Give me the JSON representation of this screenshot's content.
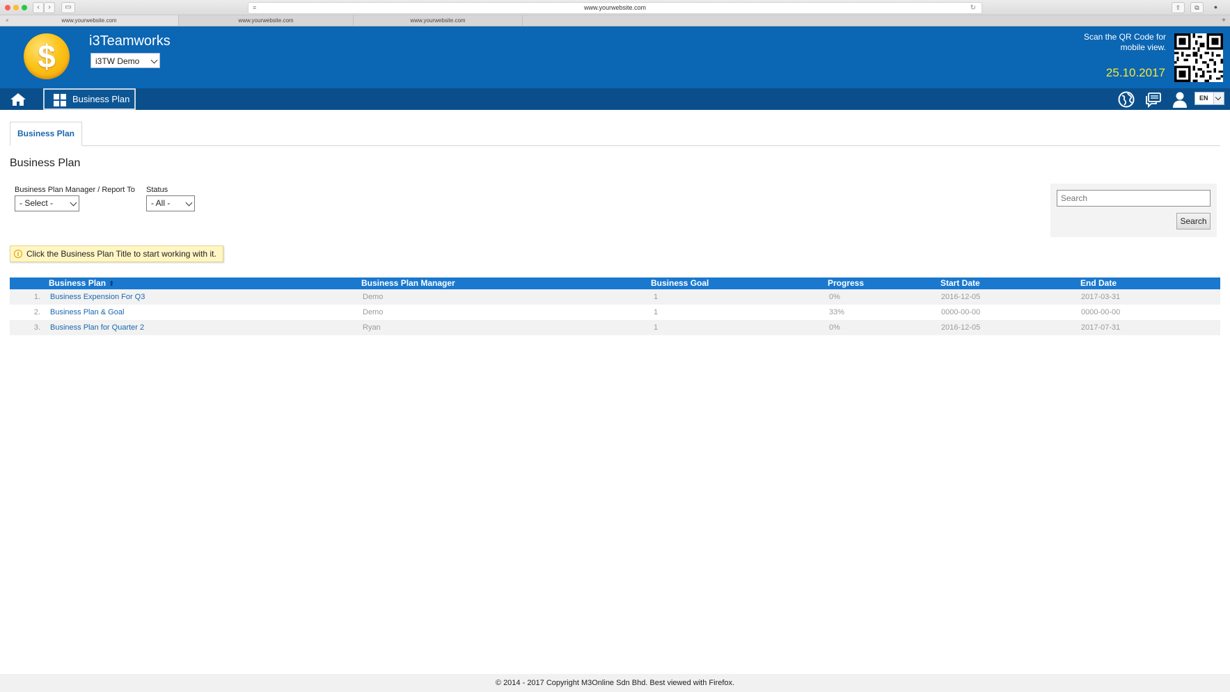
{
  "browser": {
    "url": "www.yourwebsite.com",
    "tabs": [
      "www.yourwebsite.com",
      "www.yourwebsite.com",
      "www.yourwebsite.com"
    ],
    "new_tab": "+",
    "close_tab": "×"
  },
  "header": {
    "app_name": "i3Teamworks",
    "company": "i3TW Demo",
    "qr_note": "Scan the QR Code for mobile view.",
    "date": "25.10.2017",
    "logo_symbol": "$"
  },
  "nav": {
    "module_label": "Business Plan",
    "language": "EN"
  },
  "page": {
    "tab_label": "Business Plan",
    "title": "Business Plan"
  },
  "filters": {
    "manager_label": "Business Plan Manager / Report To",
    "manager_value": "- Select -",
    "status_label": "Status",
    "status_value": "- All -"
  },
  "search": {
    "placeholder": "Search",
    "button_label": "Search"
  },
  "info": {
    "icon": "i",
    "text": "Click the Business Plan Title to start working with it."
  },
  "table": {
    "columns": [
      "Business Plan",
      "Business Plan Manager",
      "Business Goal",
      "Progress",
      "Start Date",
      "End Date"
    ],
    "rows": [
      {
        "num": "1.",
        "title": "Business Expension For Q3",
        "manager": "Demo",
        "goal": "1",
        "progress": "0%",
        "start": "2016-12-05",
        "end": "2017-03-31"
      },
      {
        "num": "2.",
        "title": "Business Plan & Goal",
        "manager": "Demo",
        "goal": "1",
        "progress": "33%",
        "start": "0000-00-00",
        "end": "0000-00-00"
      },
      {
        "num": "3.",
        "title": "Business Plan for Quarter 2",
        "manager": "Ryan",
        "goal": "1",
        "progress": "0%",
        "start": "2016-12-05",
        "end": "2017-07-31"
      }
    ]
  },
  "footer": {
    "text": "© 2014 - 2017 Copyright M3Online Sdn Bhd. Best viewed with Firefox."
  },
  "colors": {
    "header_blue": "#0b66b3",
    "nav_blue": "#0a4f8c",
    "table_header_blue": "#1a79cf",
    "link_blue": "#1a66b0",
    "date_yellow": "#f4e93a",
    "coin_gold": "#fbc419",
    "note_bg": "#fff6c4"
  },
  "icons": {
    "home": "home-icon",
    "module": "dashboard-grid-icon",
    "globe": "globe-icon",
    "chat": "chat-icon",
    "user": "user-icon"
  }
}
